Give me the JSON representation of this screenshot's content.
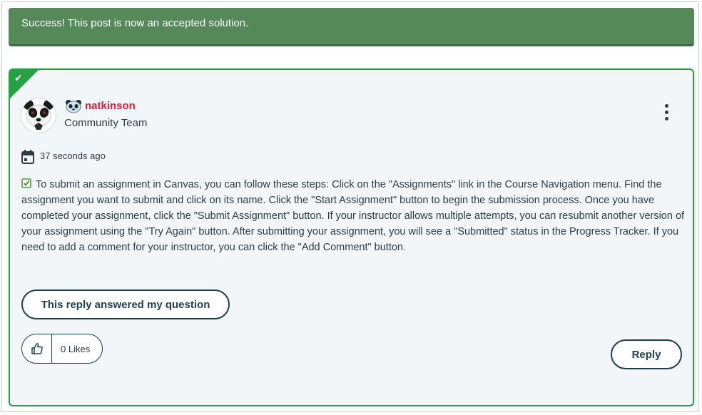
{
  "banner": {
    "message": "Success! This post is now an accepted solution."
  },
  "post": {
    "accepted_solution_icon": "check-icon",
    "author": {
      "name": "natkinson",
      "role": "Community Team",
      "avatar_icon": "panda-avatar",
      "rank_icon": "panda-rank-icon"
    },
    "menu_icon": "kebab-menu-icon",
    "timestamp": "37 seconds ago",
    "body": "To submit an assignment in Canvas, you can follow these steps: Click on the \"Assignments\" link in the Course Navigation menu. Find the assignment you want to submit and click on its name. Click the \"Start Assignment\" button to begin the submission process. Once you have completed your assignment, click the \"Submit Assignment\" button. If your instructor allows multiple attempts, you can resubmit another version of your assignment using the \"Try Again\" button. After submitting your assignment, you will see a \"Submitted\" status in the Progress Tracker. If you need to add a comment for your instructor, you can click the \"Add Comment\" button.",
    "answered_button_label": "This reply answered my question",
    "likes_label": "0 Likes",
    "reply_button_label": "Reply"
  },
  "colors": {
    "banner_bg": "#56895a",
    "solution_border": "#26a042",
    "card_bg": "#f2f6f8",
    "author_name": "#d4233a",
    "button_border": "#1f3f4f"
  }
}
